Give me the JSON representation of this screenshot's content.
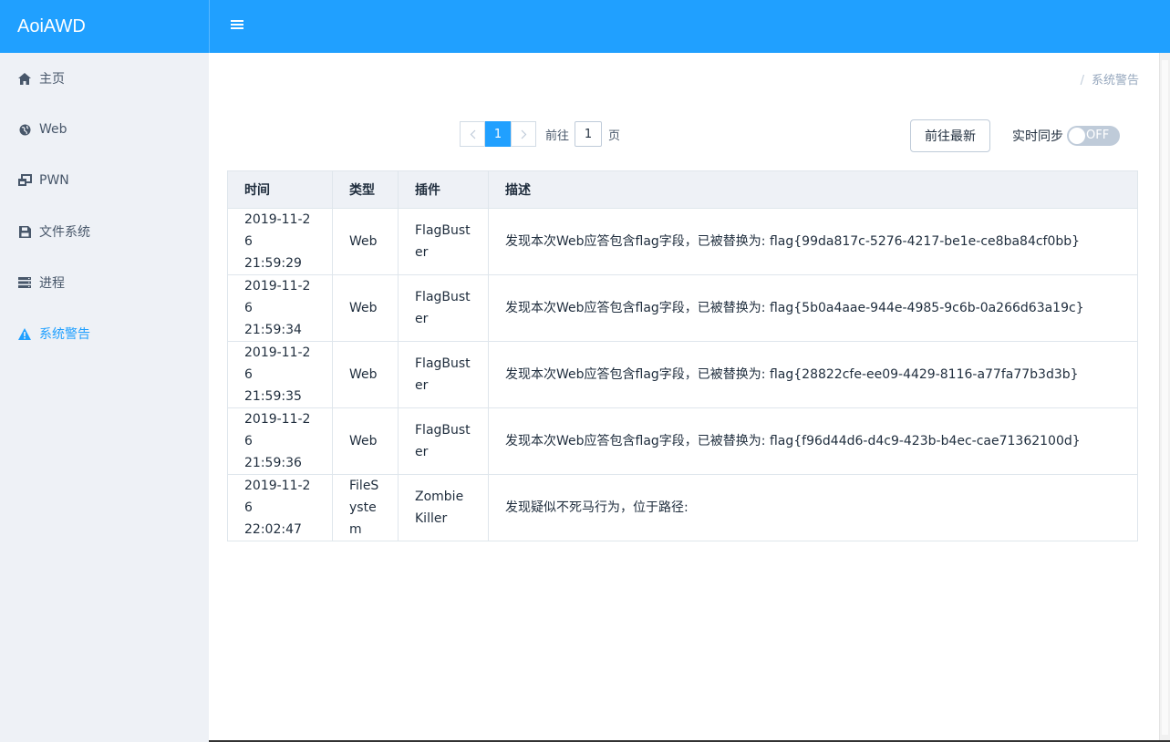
{
  "brand": "AoiAWD",
  "sidebar": {
    "items": [
      {
        "label": "主页",
        "icon": "home-icon"
      },
      {
        "label": "Web",
        "icon": "globe-icon"
      },
      {
        "label": "PWN",
        "icon": "window-restore-icon"
      },
      {
        "label": "文件系统",
        "icon": "save-icon"
      },
      {
        "label": "进程",
        "icon": "server-icon"
      },
      {
        "label": "系统警告",
        "icon": "warning-icon"
      }
    ],
    "active_index": 5
  },
  "breadcrumb": {
    "separator": "/",
    "current": "系统警告"
  },
  "pager": {
    "current": "1",
    "goto_label": "前往",
    "goto_value": "1",
    "page_suffix": "页"
  },
  "latest_button": "前往最新",
  "sync": {
    "label": "实时同步",
    "state": "OFF"
  },
  "table": {
    "headers": {
      "time": "时间",
      "type": "类型",
      "plugin": "插件",
      "desc": "描述"
    },
    "rows": [
      {
        "date": "2019-11-26",
        "clock": "21:59:29",
        "type": "Web",
        "plugin": "FlagBuster",
        "desc": "发现本次Web应答包含flag字段，已被替换为: flag{99da817c-5276-4217-be1e-ce8ba84cf0bb}"
      },
      {
        "date": "2019-11-26",
        "clock": "21:59:34",
        "type": "Web",
        "plugin": "FlagBuster",
        "desc": "发现本次Web应答包含flag字段，已被替换为: flag{5b0a4aae-944e-4985-9c6b-0a266d63a19c}"
      },
      {
        "date": "2019-11-26",
        "clock": "21:59:35",
        "type": "Web",
        "plugin": "FlagBuster",
        "desc": "发现本次Web应答包含flag字段，已被替换为: flag{28822cfe-ee09-4429-8116-a77fa77b3d3b}"
      },
      {
        "date": "2019-11-26",
        "clock": "21:59:36",
        "type": "Web",
        "plugin": "FlagBuster",
        "desc": "发现本次Web应答包含flag字段，已被替换为: flag{f96d44d6-d4c9-423b-b4ec-cae71362100d}"
      },
      {
        "date": "2019-11-26",
        "clock": "22:02:47",
        "type": "FileSystem",
        "plugin": "ZombieKiller",
        "desc": "发现疑似不死马行为，位于路径:"
      }
    ]
  },
  "colors": {
    "accent": "#20a0ff",
    "sidebar_bg": "#eef1f6",
    "header_bg": "#eef1f6"
  }
}
